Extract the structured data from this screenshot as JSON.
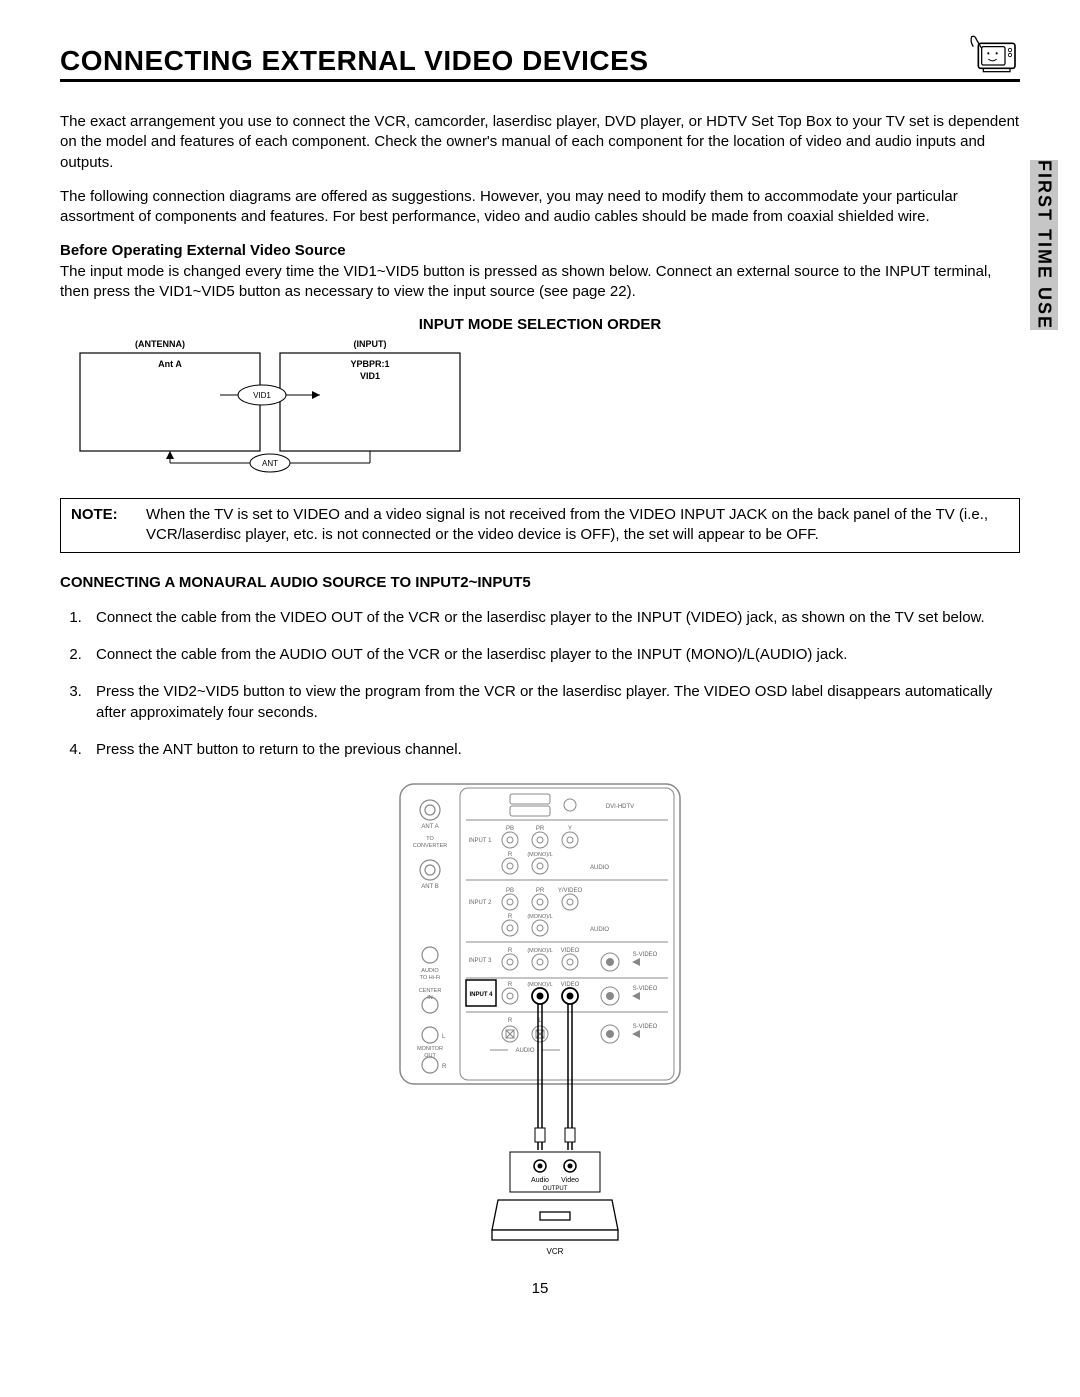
{
  "sideTab": "FIRST TIME USE",
  "title": "CONNECTING EXTERNAL VIDEO DEVICES",
  "para1": "The exact arrangement you use to connect the VCR, camcorder, laserdisc player, DVD player, or HDTV Set Top Box to your TV set is dependent on the model and features of each component.  Check the owner's manual of each component for the location of video and audio inputs and outputs.",
  "para2": "The following connection diagrams are offered as suggestions.  However, you may need to modify them to accommodate your particular assortment of components and features.  For best performance, video and audio cables should be made from coaxial shielded wire.",
  "subhead1": "Before Operating External Video Source",
  "para3": "The input mode is changed every time the VID1~VID5 button is pressed as shown below.  Connect an external source to the INPUT terminal, then press the VID1~VID5 button as necessary to view the input source (see page 22).",
  "diagramTitle": "INPUT MODE SELECTION ORDER",
  "diagram": {
    "antennaHeader": "(ANTENNA)",
    "inputHeader": "(INPUT)",
    "antA": "Ant A",
    "ypbpr": "YPBPR:1",
    "vid1": "VID1",
    "btnVid1": "VID1",
    "btnAnt": "ANT"
  },
  "noteLabel": "NOTE:",
  "noteText": "When the TV is set to VIDEO and a video signal is not received from the VIDEO INPUT JACK on the back panel of the TV (i.e., VCR/laserdisc player, etc. is not connected or the video device is OFF), the set will appear to be OFF.",
  "subhead2": "CONNECTING A MONAURAL AUDIO SOURCE TO INPUT2~INPUT5",
  "steps": [
    "Connect the cable from the VIDEO OUT of the VCR or the laserdisc player to the INPUT (VIDEO) jack, as shown on the TV set below.",
    "Connect the cable from the AUDIO OUT of the VCR or the laserdisc player to the INPUT (MONO)/L(AUDIO) jack.",
    "Press the VID2~VID5 button to view the program from the VCR or the laserdisc player.  The VIDEO OSD label disappears automatically after approximately four seconds.",
    "Press the ANT button to return to the previous channel."
  ],
  "rearPanel": {
    "antA": "ANT A",
    "toConverter": "TO\nCONVERTER",
    "antB": "ANT B",
    "audioHiFi": "AUDIO\nTO Hi-Fi",
    "centerIn": "CENTER\nIN",
    "monitorOut": "MONITOR\nOUT",
    "input1": "INPUT 1",
    "input2": "INPUT 2",
    "input3": "INPUT 3",
    "input4": "INPUT 4",
    "dvihdtv": "DVI-HDTV",
    "pb": "PB",
    "pr": "PR",
    "y": "Y",
    "yvideo": "Y/VIDEO",
    "monoL": "(MONO)/L",
    "r": "R",
    "l": "L",
    "audio": "AUDIO",
    "video": "VIDEO",
    "svideo": "S-VIDEO",
    "outAudio": "Audio",
    "outVideo": "Video",
    "output": "OUTPUT",
    "vcr": "VCR"
  },
  "pageNum": "15"
}
